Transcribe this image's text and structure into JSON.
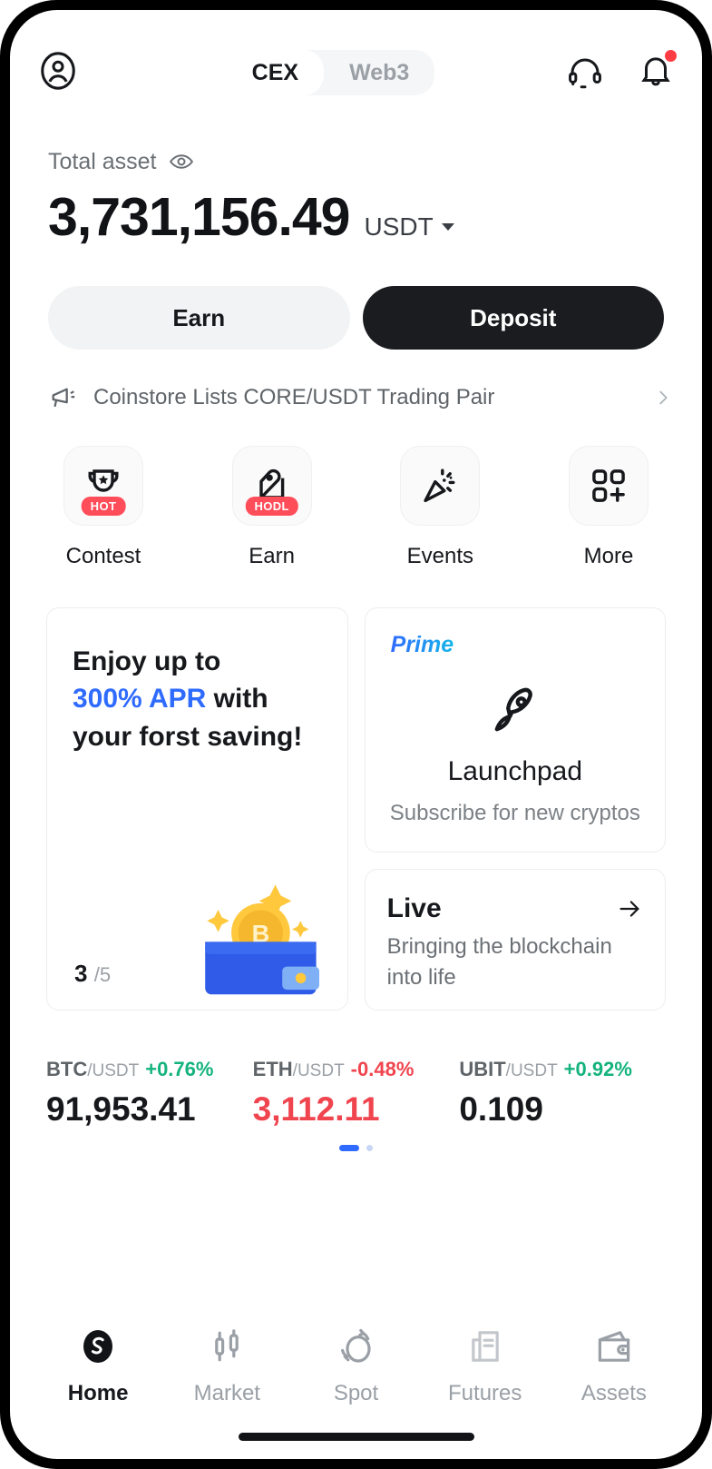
{
  "header": {
    "avatar_icon": "user-circle-icon",
    "tabs": [
      {
        "label": "CEX",
        "active": true
      },
      {
        "label": "Web3",
        "active": false
      }
    ],
    "support_icon": "headset-icon",
    "notification_icon": "bell-icon"
  },
  "balance": {
    "label": "Total asset",
    "eye_icon": "eye-icon",
    "amount": "3,731,156.49",
    "currency": "USDT",
    "caret_icon": "chevron-down-icon"
  },
  "actions": {
    "earn_label": "Earn",
    "deposit_label": "Deposit"
  },
  "announcement": {
    "icon": "megaphone-icon",
    "text": "Coinstore Lists CORE/USDT Trading Pair",
    "chevron_icon": "chevron-right-icon"
  },
  "quick_actions": [
    {
      "label": "Contest",
      "icon": "trophy-icon",
      "badge": "HOT"
    },
    {
      "label": "Earn",
      "icon": "piggy-hand-icon",
      "badge": "HODL"
    },
    {
      "label": "Events",
      "icon": "party-popper-icon",
      "badge": ""
    },
    {
      "label": "More",
      "icon": "grid-plus-icon",
      "badge": ""
    }
  ],
  "promo": {
    "line1": "Enjoy up to",
    "accent": "300% APR",
    "line2_tail": " with",
    "line3": "your forst saving!",
    "counter_current": "3",
    "counter_total": "/5",
    "art_icon": "wallet-bitcoin-icon"
  },
  "launchpad": {
    "tag": "Prime",
    "icon": "rocket-icon",
    "title": "Launchpad",
    "subtitle": "Subscribe for new cryptos"
  },
  "live": {
    "title": "Live",
    "arrow_icon": "arrow-right-icon",
    "subtitle": "Bringing the blockchain into life"
  },
  "tickers": [
    {
      "symbol": "BTC",
      "quote": "/USDT",
      "change": "+0.76%",
      "direction": "up",
      "price": "91,953.41",
      "price_color": "neutral"
    },
    {
      "symbol": "ETH",
      "quote": "/USDT",
      "change": "-0.48%",
      "direction": "down",
      "price": "3,112.11",
      "price_color": "down"
    },
    {
      "symbol": "UBIT",
      "quote": "/USDT",
      "change": "+0.92%",
      "direction": "up",
      "price": "0.109",
      "price_color": "neutral"
    }
  ],
  "carousel": {
    "pages": 2,
    "active_index": 0
  },
  "bottom_nav": [
    {
      "label": "Home",
      "icon": "home-logo-icon",
      "active": true
    },
    {
      "label": "Market",
      "icon": "candlestick-icon",
      "active": false
    },
    {
      "label": "Spot",
      "icon": "swap-icon",
      "active": false
    },
    {
      "label": "Futures",
      "icon": "chart-document-icon",
      "active": false
    },
    {
      "label": "Assets",
      "icon": "wallet-icon",
      "active": false
    }
  ],
  "colors": {
    "accent_blue": "#2f6bff",
    "up_green": "#14b37d",
    "down_red": "#f0444e",
    "badge_red": "#ff4d5a",
    "dark": "#1a1c1f"
  }
}
